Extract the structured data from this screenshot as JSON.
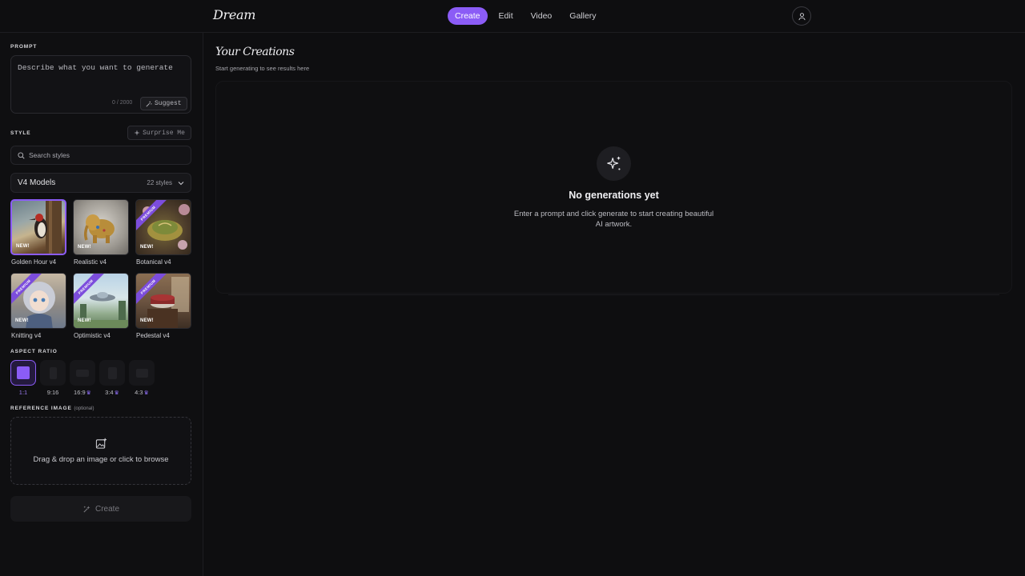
{
  "app": {
    "logo": "Dream"
  },
  "nav": {
    "items": [
      {
        "label": "Create",
        "active": true
      },
      {
        "label": "Edit",
        "active": false
      },
      {
        "label": "Video",
        "active": false
      },
      {
        "label": "Gallery",
        "active": false
      }
    ]
  },
  "sidebar": {
    "prompt_label": "PROMPT",
    "prompt_placeholder": "Describe what you want to generate",
    "char_count": "0 / 2000",
    "suggest_label": "Suggest",
    "style_label": "STYLE",
    "surprise_label": "Surprise Me",
    "search_placeholder": "Search styles",
    "model_group": "V4 Models",
    "style_count": "22 styles",
    "styles": [
      {
        "label": "Golden Hour v4",
        "badge": "NEW!",
        "ribbon": "",
        "selected": true
      },
      {
        "label": "Realistic v4",
        "badge": "NEW!",
        "ribbon": "",
        "selected": false
      },
      {
        "label": "Botanical v4",
        "badge": "NEW!",
        "ribbon": "PREMIUM",
        "selected": false
      },
      {
        "label": "Knitting v4",
        "badge": "NEW!",
        "ribbon": "PREMIUM",
        "selected": false
      },
      {
        "label": "Optimistic v4",
        "badge": "NEW!",
        "ribbon": "PREMIUM",
        "selected": false
      },
      {
        "label": "Pedestal v4",
        "badge": "NEW!",
        "ribbon": "PREMIUM",
        "selected": false
      }
    ],
    "aspect_label": "ASPECT RATIO",
    "ratios": [
      {
        "label": "1:1",
        "premium": false,
        "selected": true
      },
      {
        "label": "9:16",
        "premium": false,
        "selected": false
      },
      {
        "label": "16:9",
        "premium": true,
        "selected": false
      },
      {
        "label": "3:4",
        "premium": true,
        "selected": false
      },
      {
        "label": "4:3",
        "premium": true,
        "selected": false
      }
    ],
    "reference_label": "REFERENCE IMAGE",
    "reference_optional": "(optional)",
    "dropzone_text": "Drag & drop an image or click to browse",
    "create_label": "Create"
  },
  "main": {
    "title": "Your Creations",
    "subtitle": "Start generating to see results here",
    "empty_title": "No generations yet",
    "empty_desc": "Enter a prompt and click generate to start creating beautiful AI artwork."
  },
  "colors": {
    "accent": "#8b5cf6",
    "background": "#0e0e10"
  }
}
